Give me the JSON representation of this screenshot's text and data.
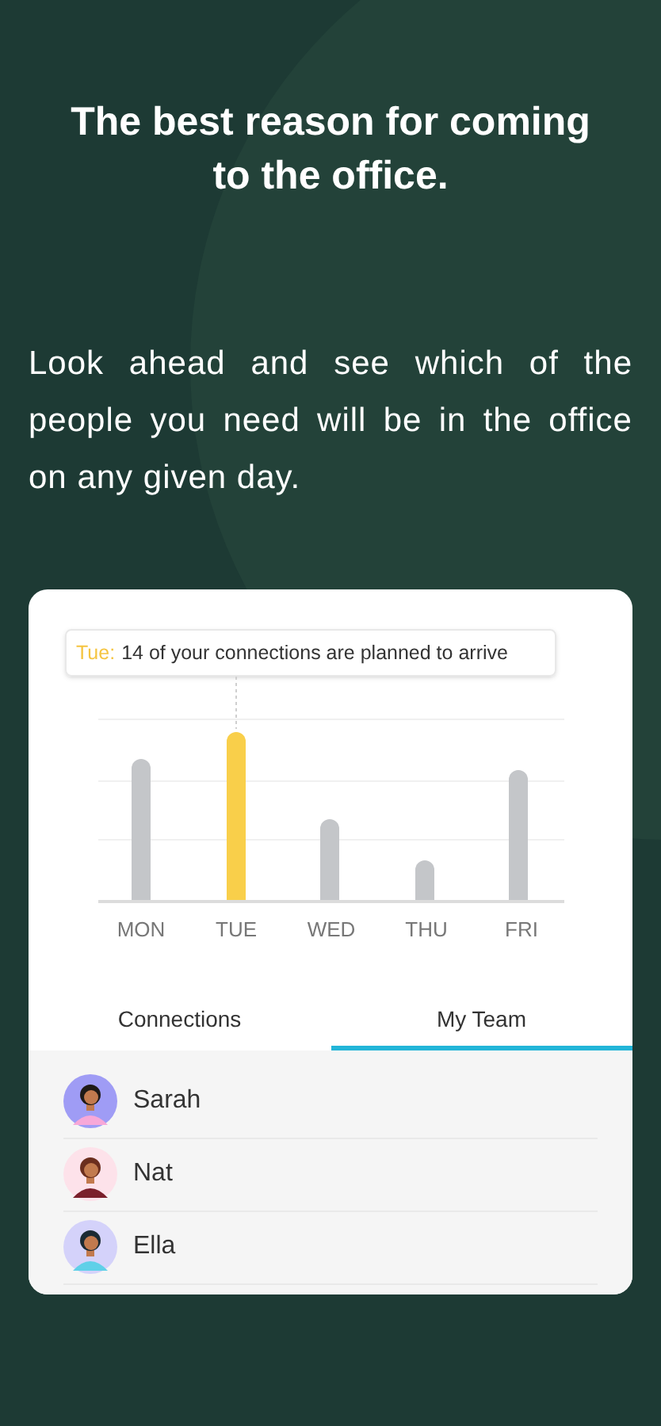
{
  "headline": "The best reason for coming to the office.",
  "description": "Look ahead and see which of the people you need will be in the office on any given day.",
  "tooltip": {
    "day": "Tue:",
    "text": "14 of your connections are planned to arrive"
  },
  "days": [
    {
      "label": "MON",
      "selected": false
    },
    {
      "label": "TUE",
      "selected": true
    },
    {
      "label": "WED",
      "selected": false
    },
    {
      "label": "THU",
      "selected": false
    },
    {
      "label": "FRI",
      "selected": false
    }
  ],
  "tabs": [
    {
      "label": "Connections",
      "selected": false
    },
    {
      "label": "My Team",
      "selected": true
    }
  ],
  "team": [
    {
      "name": "Sarah",
      "color": "#9f9cf5"
    },
    {
      "name": "Nat",
      "color": "#fde2ea"
    },
    {
      "name": "Ella",
      "color": "#d4d2fa"
    }
  ]
}
